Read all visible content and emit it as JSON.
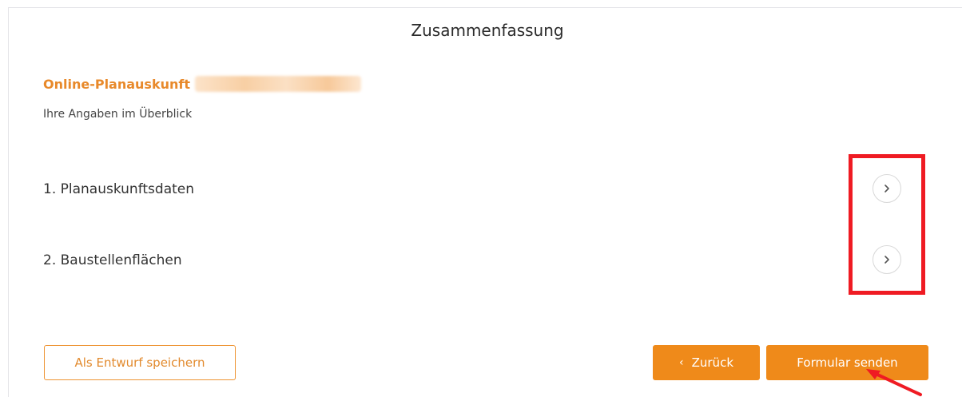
{
  "page": {
    "title": "Zusammenfassung"
  },
  "summary": {
    "heading": "Online-Planauskunft",
    "subtitle": "Ihre Angaben im Überblick"
  },
  "sections": [
    {
      "label": "1. Planauskunftsdaten",
      "icon": "chevron-right-icon"
    },
    {
      "label": "2. Baustellenflächen",
      "icon": "chevron-right-icon"
    }
  ],
  "buttons": {
    "save_draft": "Als Entwurf speichern",
    "back": "Zurück",
    "back_icon": "‹",
    "submit": "Formular senden"
  },
  "colors": {
    "accent": "#ef8a1a",
    "heading_orange": "#e8892a",
    "annotation_red": "#ef1b23"
  }
}
